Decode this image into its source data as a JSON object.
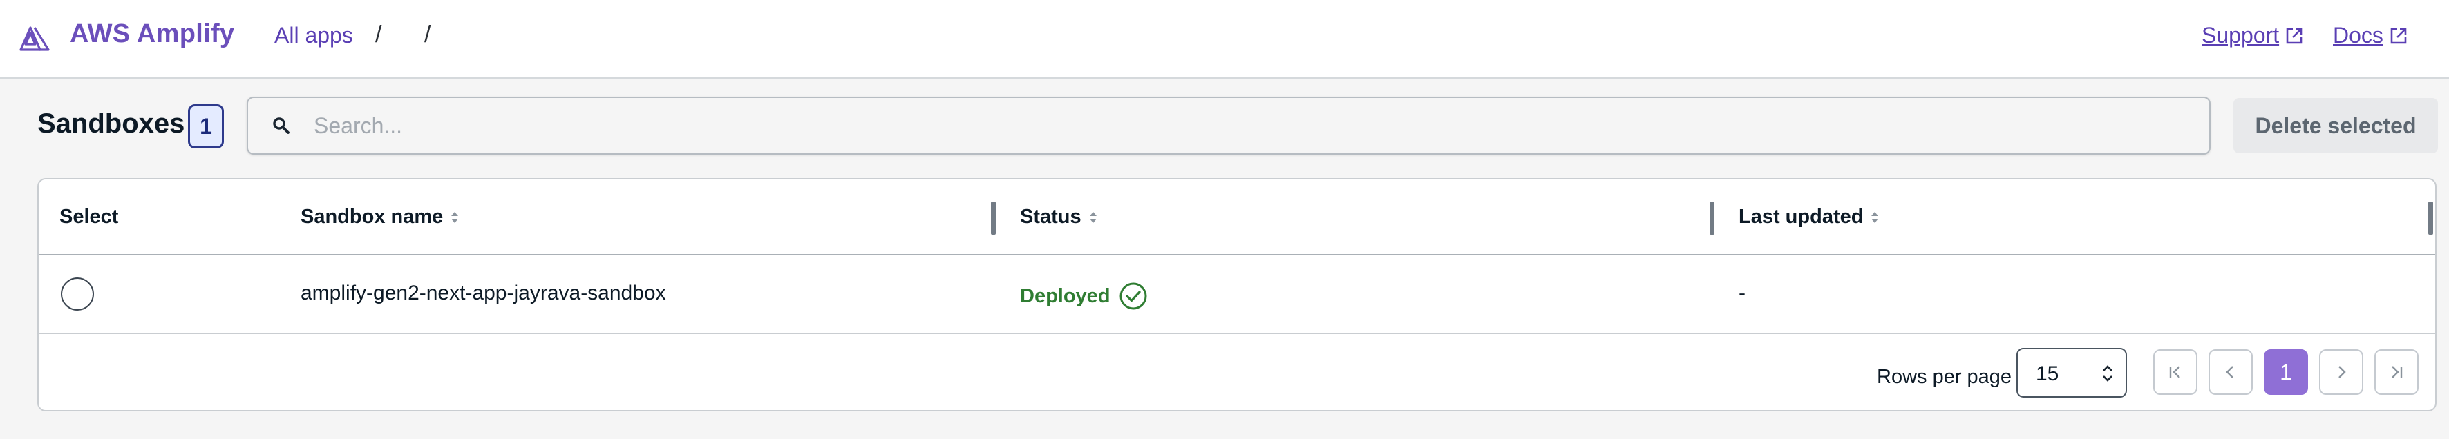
{
  "header": {
    "brand": "AWS Amplify",
    "breadcrumb": {
      "apps": "All apps",
      "sep": "/"
    },
    "links": {
      "support": "Support",
      "docs": "Docs"
    }
  },
  "toolbar": {
    "title": "Sandboxes",
    "count": "1",
    "search_placeholder": "Search...",
    "search_value": "",
    "delete_label": "Delete selected"
  },
  "table": {
    "columns": [
      "Select",
      "Sandbox name",
      "Status",
      "Last updated"
    ],
    "rows": [
      {
        "name": "amplify-gen2-next-app-jayrava-sandbox",
        "status": "Deployed",
        "last_updated": "-"
      }
    ]
  },
  "pagination": {
    "rows_per_page_label": "Rows per page",
    "rows_per_page": "15",
    "current_page": "1"
  },
  "colors": {
    "accent": "#6b4fbb",
    "status_success": "#2f7d32",
    "page_current": "#8f6fd6"
  },
  "icons": [
    "amplify-logo",
    "external-link-icon",
    "search-icon",
    "sort-icon",
    "check-circle-icon",
    "chevron-updown-icon",
    "first-page-icon",
    "prev-page-icon",
    "next-page-icon",
    "last-page-icon"
  ]
}
